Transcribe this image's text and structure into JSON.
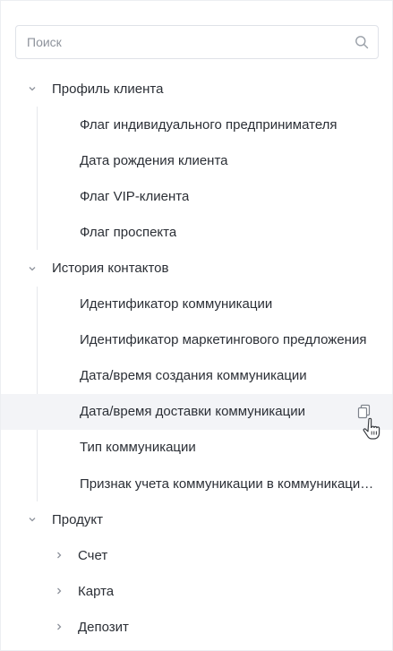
{
  "search": {
    "placeholder": "Поиск"
  },
  "tree": {
    "groups": [
      {
        "label": "Профиль клиента",
        "items": [
          "Флаг индивидуального предпринимателя",
          "Дата рождения клиента",
          "Флаг VIP-клиента",
          "Флаг проспекта"
        ]
      },
      {
        "label": "История контактов",
        "items": [
          "Идентификатор коммуникации",
          "Идентификатор маркетингового предложения",
          "Дата/время создания коммуникации",
          "Дата/время доставки коммуникации",
          "Тип коммуникации",
          "Признак учета коммуникации в коммуникационном лимите"
        ]
      },
      {
        "label": "Продукт",
        "subgroups": [
          "Счет",
          "Карта",
          "Депозит"
        ]
      }
    ]
  },
  "icons": {
    "search": "search-icon",
    "expanded": "chevron-down-icon",
    "collapsed": "chevron-right-icon",
    "copy": "copy-icon",
    "cursor": "hand-pointer-cursor-icon"
  },
  "colors": {
    "text": "#2b2f36",
    "placeholder": "#8e939c",
    "border": "#dfe2e8",
    "hover_row": "#f3f4f7",
    "guide_line": "#e6e8ec"
  }
}
